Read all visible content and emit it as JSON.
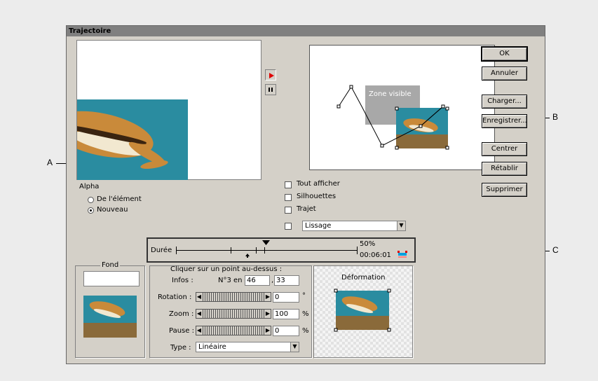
{
  "window": {
    "title": "Trajectoire"
  },
  "buttons": {
    "ok": "OK",
    "cancel": "Annuler",
    "load": "Charger...",
    "save": "Enregistrer...",
    "center": "Centrer",
    "reset": "Rétablir",
    "delete": "Supprimer"
  },
  "playback": {
    "play_icon": "play-icon",
    "pause_icon": "pause-icon"
  },
  "preview": {
    "zone_label": "Zone visible"
  },
  "alpha": {
    "label": "Alpha",
    "options": [
      {
        "label": "De l'élément",
        "selected": false
      },
      {
        "label": "Nouveau",
        "selected": true
      }
    ]
  },
  "display_options": [
    {
      "label": "Tout afficher",
      "checked": false
    },
    {
      "label": "Silhouettes",
      "checked": false
    },
    {
      "label": "Trajet",
      "checked": false
    }
  ],
  "smoothing": {
    "checked": false,
    "value": "Lissage"
  },
  "duration": {
    "label": "Durée",
    "percent": "50%",
    "time": "00:06:01"
  },
  "background": {
    "label": "Fond",
    "value": ""
  },
  "point": {
    "instruction": "Cliquer sur un point au-dessus :",
    "info_label": "Infos :",
    "info_text": "N°3 en",
    "x": "46",
    "y": "33",
    "rotation_label": "Rotation :",
    "rotation_value": "0",
    "rotation_unit": "°",
    "zoom_label": "Zoom :",
    "zoom_value": "100",
    "zoom_unit": "%",
    "pause_label": "Pause :",
    "pause_value": "0",
    "pause_unit": "%",
    "type_label": "Type :",
    "type_value": "Linéaire"
  },
  "deformation": {
    "label": "Déformation"
  },
  "callouts": {
    "a": "A",
    "b": "B",
    "c": "C"
  },
  "colors": {
    "sky": "#2a8ca0",
    "ground": "#8a6a3a",
    "accent_red": "#e00000"
  }
}
